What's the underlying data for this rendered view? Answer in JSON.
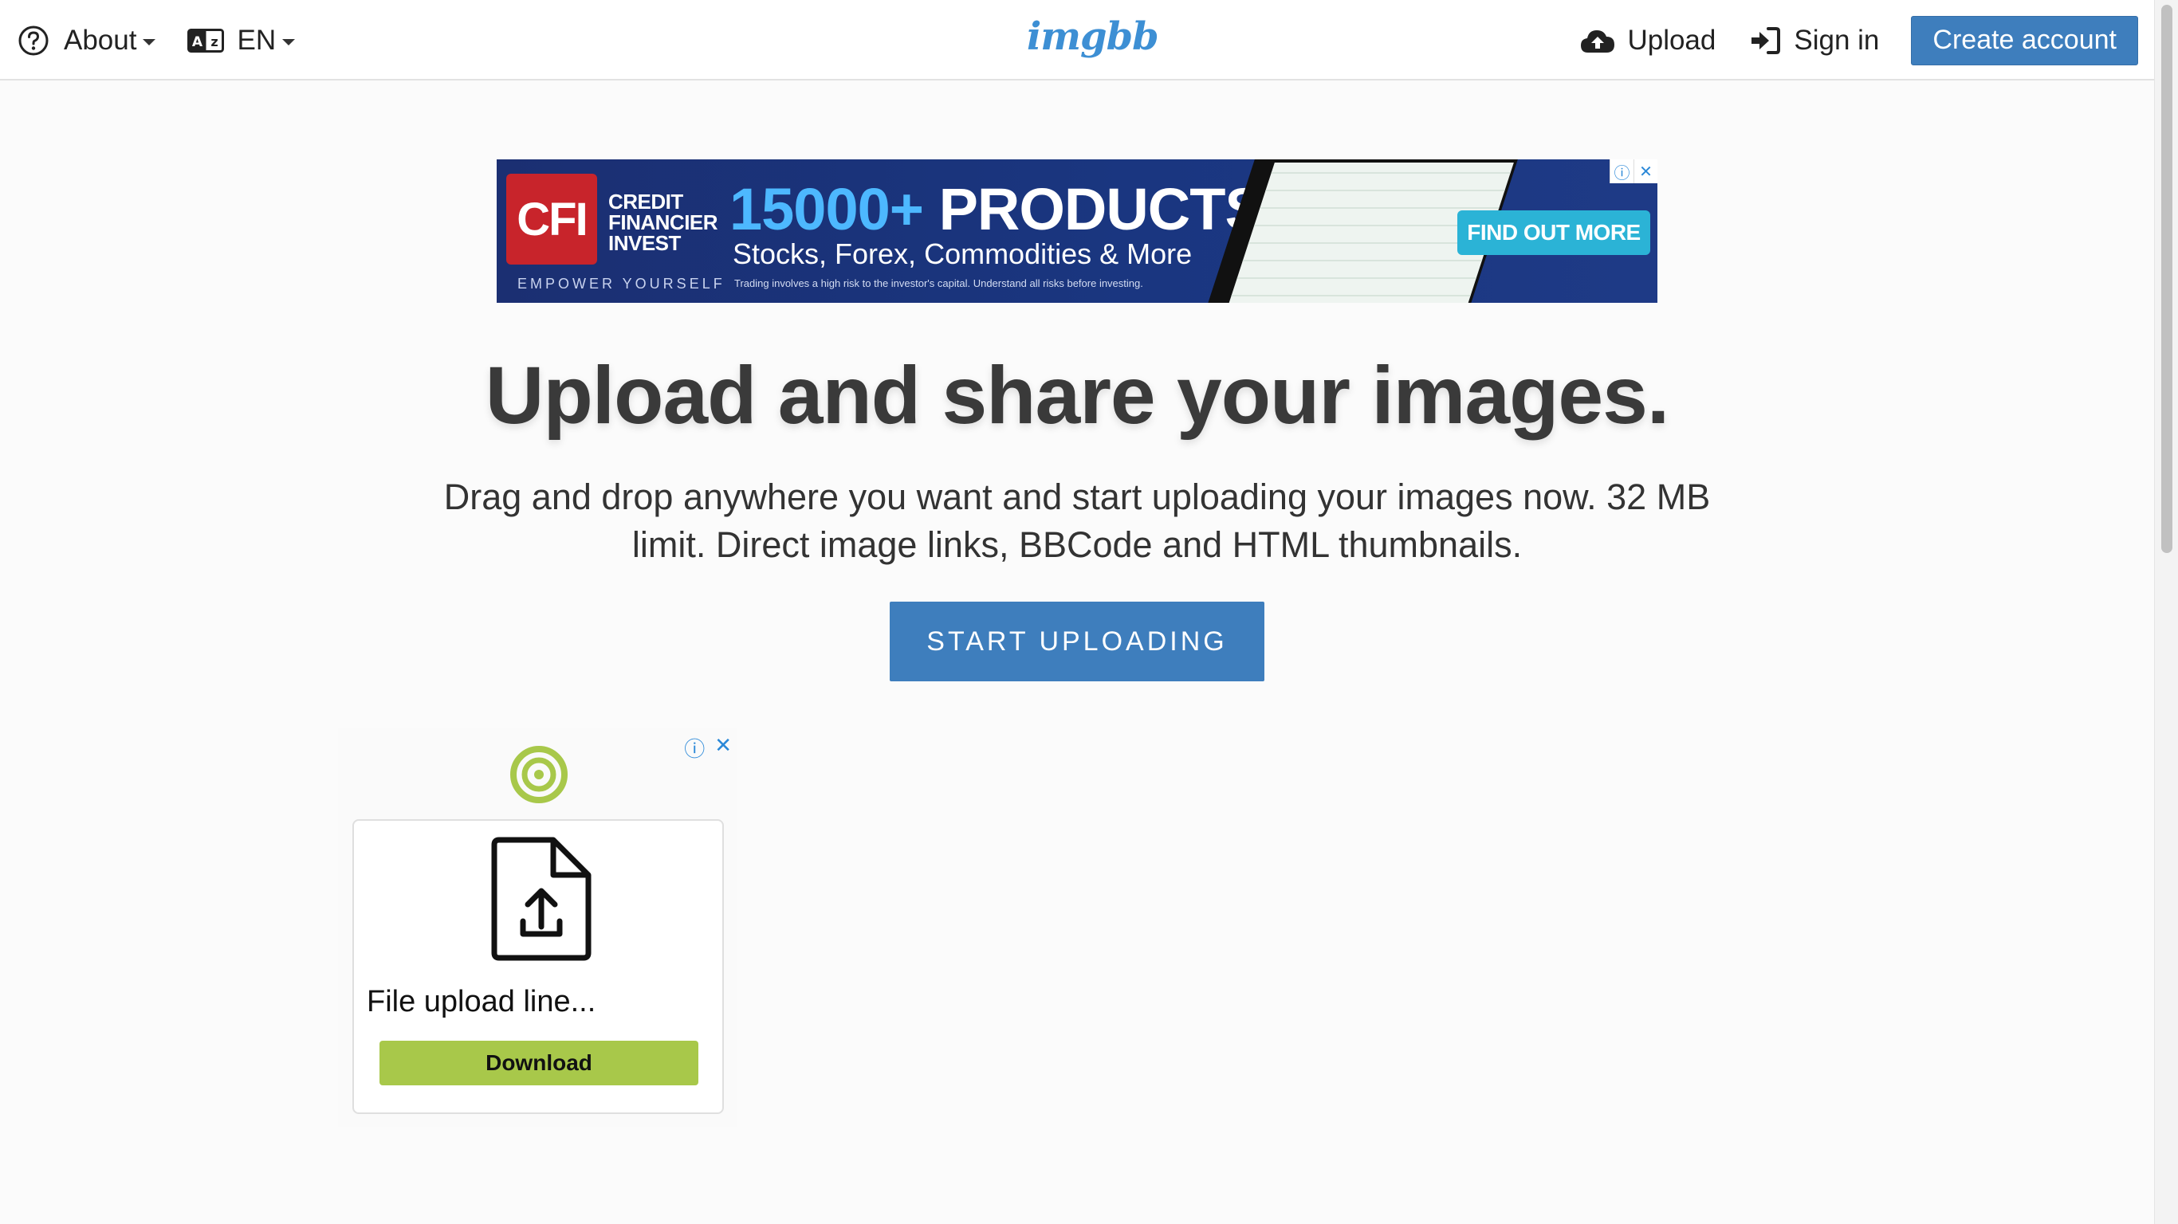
{
  "header": {
    "about_label": "About",
    "lang_label": "EN",
    "logo_text": "imgbb",
    "upload_label": "Upload",
    "signin_label": "Sign in",
    "create_account_label": "Create account"
  },
  "banner_ad": {
    "brand_abbr": "CFI",
    "brand_line1": "CREDIT",
    "brand_line2": "FINANCIER",
    "brand_line3": "INVEST",
    "tagline": "EMPOWER YOURSELF",
    "headline_num": "15000+",
    "headline_word": "PRODUCTS",
    "subline": "Stocks, Forex, Commodities & More",
    "disclaimer": "Trading involves a high risk to the investor's capital. Understand all risks before investing.",
    "cta": "FIND OUT MORE",
    "info_glyph": "ⓘ",
    "close_glyph": "✕"
  },
  "hero": {
    "title": "Upload and share your images.",
    "description": "Drag and drop anywhere you want and start uploading your images now. 32 MB limit. Direct image links, BBCode and HTML thumbnails.",
    "button": "START UPLOADING"
  },
  "side_ad": {
    "title": "File upload line...",
    "button": "Download",
    "info_glyph": "ⓘ",
    "close_glyph": "✕"
  },
  "colors": {
    "accent": "#3e7ebd",
    "logo": "#3d8fd4",
    "ad_green": "#a8c84a"
  },
  "icons": {
    "about": "question-circle-icon",
    "lang": "language-icon",
    "upload": "cloud-upload-icon",
    "signin": "sign-in-icon",
    "spiral": "spiral-logo-icon",
    "doc": "file-upload-icon"
  }
}
